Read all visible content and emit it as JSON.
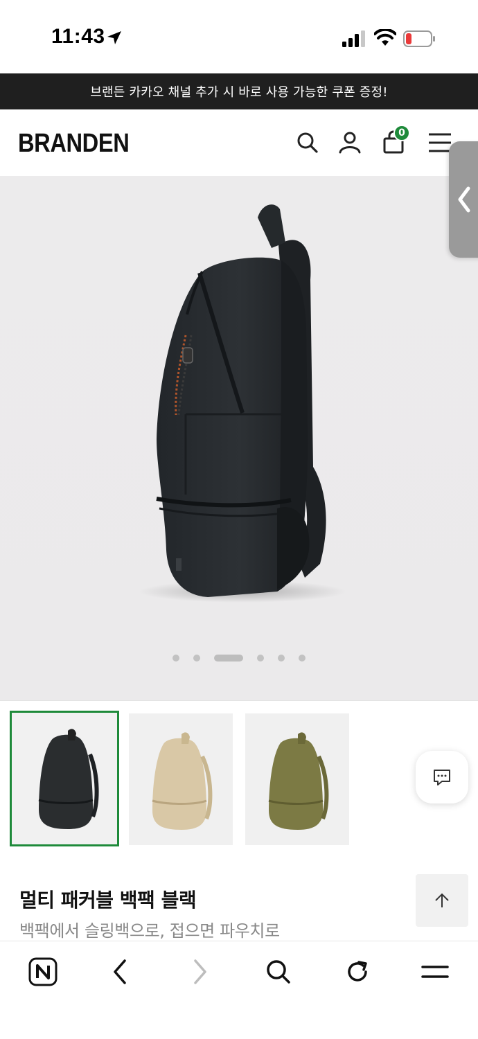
{
  "status_bar": {
    "time": "11:43"
  },
  "promo": {
    "text": "브랜든 카카오 채널 추가 시 바로 사용 가능한 쿠폰 증정!"
  },
  "header": {
    "brand": "BRANDEN",
    "cart_count": "0",
    "icons": [
      "search-icon",
      "user-icon",
      "shopping-bag-icon",
      "hamburger-menu-icon"
    ]
  },
  "side_tab": {
    "icon": "chevron-left-icon"
  },
  "gallery": {
    "slide_count": 6,
    "active_slide": 3
  },
  "thumbnails": [
    {
      "color_name": "black",
      "color": "#2a2d2f",
      "selected": true
    },
    {
      "color_name": "beige",
      "color": "#d9c8a6",
      "selected": false
    },
    {
      "color_name": "olive",
      "color": "#7c7a44",
      "selected": false
    }
  ],
  "product": {
    "title": "멀티 패커블 백팩 블랙",
    "subtitle": "백팩에서 슬링백으로, 접으면 파우치로"
  },
  "colors": {
    "accent_green": "#1e8a3a",
    "promo_bg": "#1f1f1f"
  },
  "browser_bar": {
    "icons": [
      "naver-n-icon",
      "back-icon",
      "forward-icon",
      "search-icon",
      "reload-icon",
      "menu-icon"
    ]
  }
}
